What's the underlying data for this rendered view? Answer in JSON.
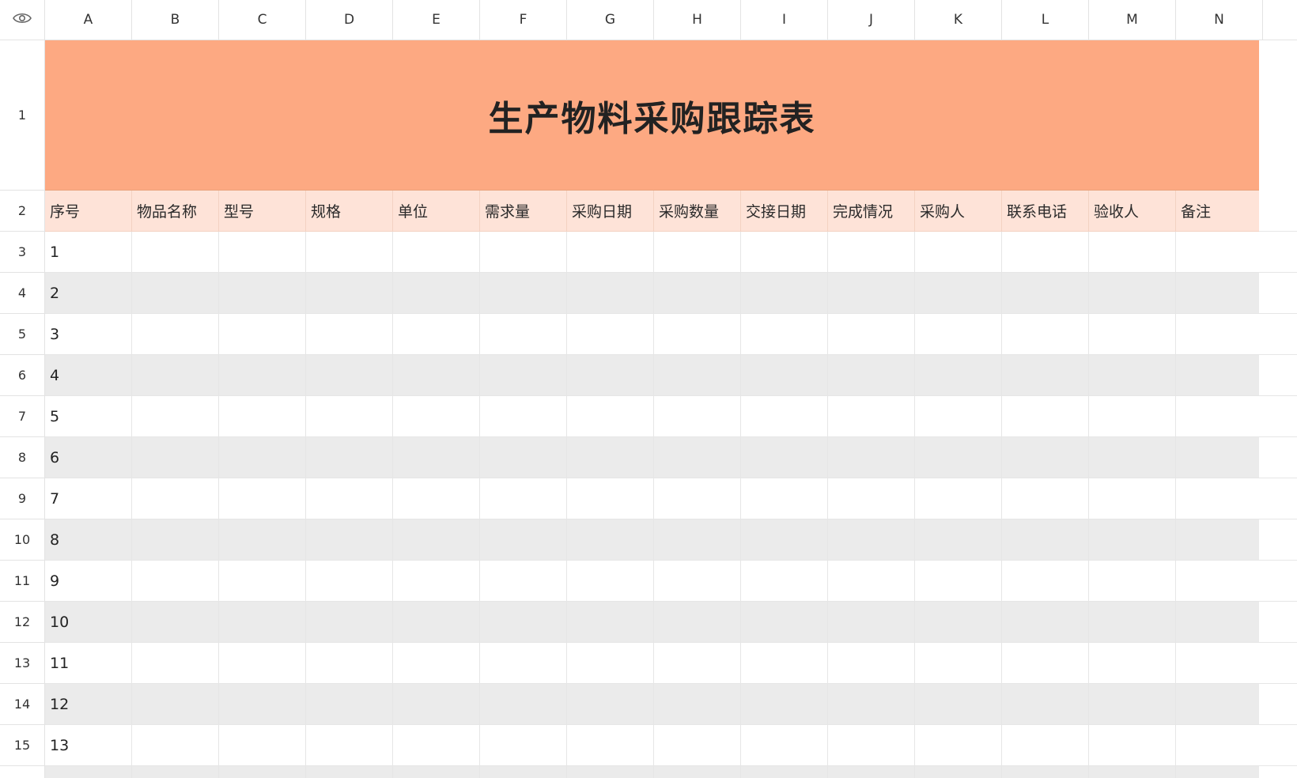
{
  "colors": {
    "title_bg": "#fda982",
    "header_bg": "#fee3d8",
    "stripe_bg": "#ebebeb",
    "plain_bg": "#ffffff"
  },
  "toolbar": {
    "visibility_icon": "eye-icon"
  },
  "columns": [
    "A",
    "B",
    "C",
    "D",
    "E",
    "F",
    "G",
    "H",
    "I",
    "J",
    "K",
    "L",
    "M",
    "N"
  ],
  "row_numbers": [
    "1",
    "2",
    "3",
    "4",
    "5",
    "6",
    "7",
    "8",
    "9",
    "10",
    "11",
    "12",
    "13",
    "14",
    "15"
  ],
  "sheet": {
    "title": "生产物料采购跟踪表",
    "headers": [
      "序号",
      "物品名称",
      "型号",
      "规格",
      "单位",
      "需求量",
      "采购日期",
      "采购数量",
      "交接日期",
      "完成情况",
      "采购人",
      "联系电话",
      "验收人",
      "备注"
    ],
    "rows": [
      [
        "1",
        "",
        "",
        "",
        "",
        "",
        "",
        "",
        "",
        "",
        "",
        "",
        "",
        ""
      ],
      [
        "2",
        "",
        "",
        "",
        "",
        "",
        "",
        "",
        "",
        "",
        "",
        "",
        "",
        ""
      ],
      [
        "3",
        "",
        "",
        "",
        "",
        "",
        "",
        "",
        "",
        "",
        "",
        "",
        "",
        ""
      ],
      [
        "4",
        "",
        "",
        "",
        "",
        "",
        "",
        "",
        "",
        "",
        "",
        "",
        "",
        ""
      ],
      [
        "5",
        "",
        "",
        "",
        "",
        "",
        "",
        "",
        "",
        "",
        "",
        "",
        "",
        ""
      ],
      [
        "6",
        "",
        "",
        "",
        "",
        "",
        "",
        "",
        "",
        "",
        "",
        "",
        "",
        ""
      ],
      [
        "7",
        "",
        "",
        "",
        "",
        "",
        "",
        "",
        "",
        "",
        "",
        "",
        "",
        ""
      ],
      [
        "8",
        "",
        "",
        "",
        "",
        "",
        "",
        "",
        "",
        "",
        "",
        "",
        "",
        ""
      ],
      [
        "9",
        "",
        "",
        "",
        "",
        "",
        "",
        "",
        "",
        "",
        "",
        "",
        "",
        ""
      ],
      [
        "10",
        "",
        "",
        "",
        "",
        "",
        "",
        "",
        "",
        "",
        "",
        "",
        "",
        ""
      ],
      [
        "11",
        "",
        "",
        "",
        "",
        "",
        "",
        "",
        "",
        "",
        "",
        "",
        "",
        ""
      ],
      [
        "12",
        "",
        "",
        "",
        "",
        "",
        "",
        "",
        "",
        "",
        "",
        "",
        "",
        ""
      ],
      [
        "13",
        "",
        "",
        "",
        "",
        "",
        "",
        "",
        "",
        "",
        "",
        "",
        "",
        ""
      ]
    ]
  }
}
